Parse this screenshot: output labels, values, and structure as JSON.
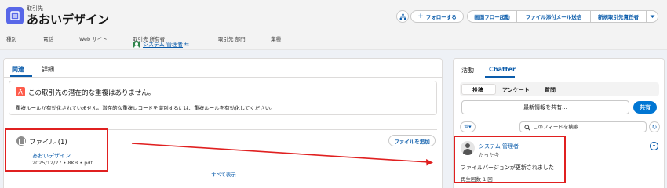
{
  "header": {
    "object_type": "取引先",
    "record_name": "あおいデザイン",
    "buttons": {
      "follow": "フォローする",
      "screen_flow": "画面フロー起動",
      "file_mail": "ファイル添付メール送信",
      "new_owner": "新規取引先責任者"
    },
    "fields": {
      "type": "種別",
      "phone": "電話",
      "website": "Web サイト",
      "owner": "取引先 所有者",
      "owner_value": "システム 管理者",
      "department": "取引先 部門",
      "industry": "業種"
    }
  },
  "left": {
    "tabs": [
      "関連",
      "詳細"
    ],
    "duplicate": {
      "title": "この取引先の潜在的な重複はありません。",
      "body": "重複ルールが有効化されていません。潜在的な重複レコードを識別するには、重複ルールを有効化してください。"
    },
    "files": {
      "title": "ファイル (1)",
      "add_button": "ファイルを追加",
      "file_name": "あおいデザイン",
      "file_meta": "2025/12/27 • 8KB • pdf",
      "view_all": "すべて表示"
    }
  },
  "right": {
    "tabs": [
      "活動",
      "Chatter"
    ],
    "sub_tabs": [
      "投稿",
      "アンケート",
      "質問"
    ],
    "share_placeholder": "最新情報を共有...",
    "share_button": "共有",
    "search_placeholder": "このフィードを検索...",
    "post": {
      "author": "システム 管理者",
      "time": "たった今",
      "body": "ファイルバージョンが更新されました",
      "plays": "再生回数 1 回"
    }
  },
  "colors": {
    "brand": "#0b5cab",
    "share_button": "#0176d3",
    "record_icon": "#5867e8",
    "duplicate_icon": "#fe5c4c",
    "annotation_red": "#e02020"
  }
}
